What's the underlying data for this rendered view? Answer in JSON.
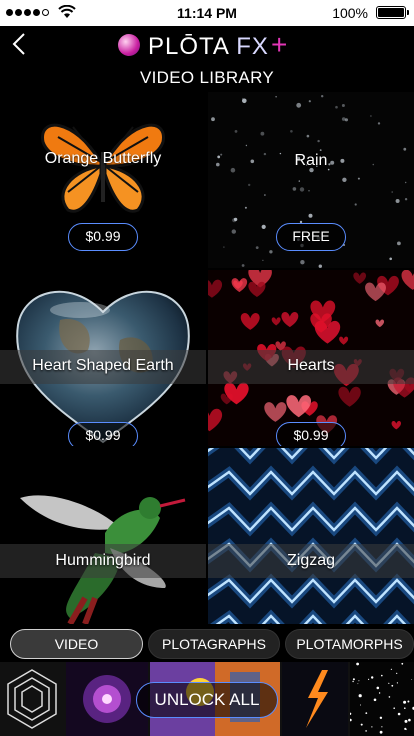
{
  "status_bar": {
    "time": "11:14 PM",
    "battery_pct": "100%",
    "battery_level": 1.0
  },
  "header": {
    "logo_text_main": "PLŌTA",
    "logo_text_fx": "FX",
    "logo_plus": "+"
  },
  "section": {
    "title": "VIDEO LIBRARY"
  },
  "tiles": [
    {
      "name": "Orange Butterfly",
      "price": "$0.99"
    },
    {
      "name": "Rain",
      "price": "FREE"
    },
    {
      "name": "Heart Shaped Earth",
      "price": "$0.99"
    },
    {
      "name": "Hearts",
      "price": "$0.99"
    },
    {
      "name": "Hummingbird"
    },
    {
      "name": "Zigzag"
    }
  ],
  "tabs": [
    {
      "label": "VIDEO",
      "active": true
    },
    {
      "label": "PLOTAGRAPHS",
      "active": false
    },
    {
      "label": "PLOTAMORPHS",
      "active": false
    }
  ],
  "unlock": {
    "label": "UNLOCK ALL"
  },
  "icons": {
    "back": "chevron-left-icon",
    "wifi": "wifi-icon",
    "battery": "battery-icon",
    "signal": "signal-dots-icon",
    "logo": "plota-logo-icon"
  },
  "colors": {
    "accent_blue": "#5a8dff",
    "brand_pink": "#e236b6"
  }
}
